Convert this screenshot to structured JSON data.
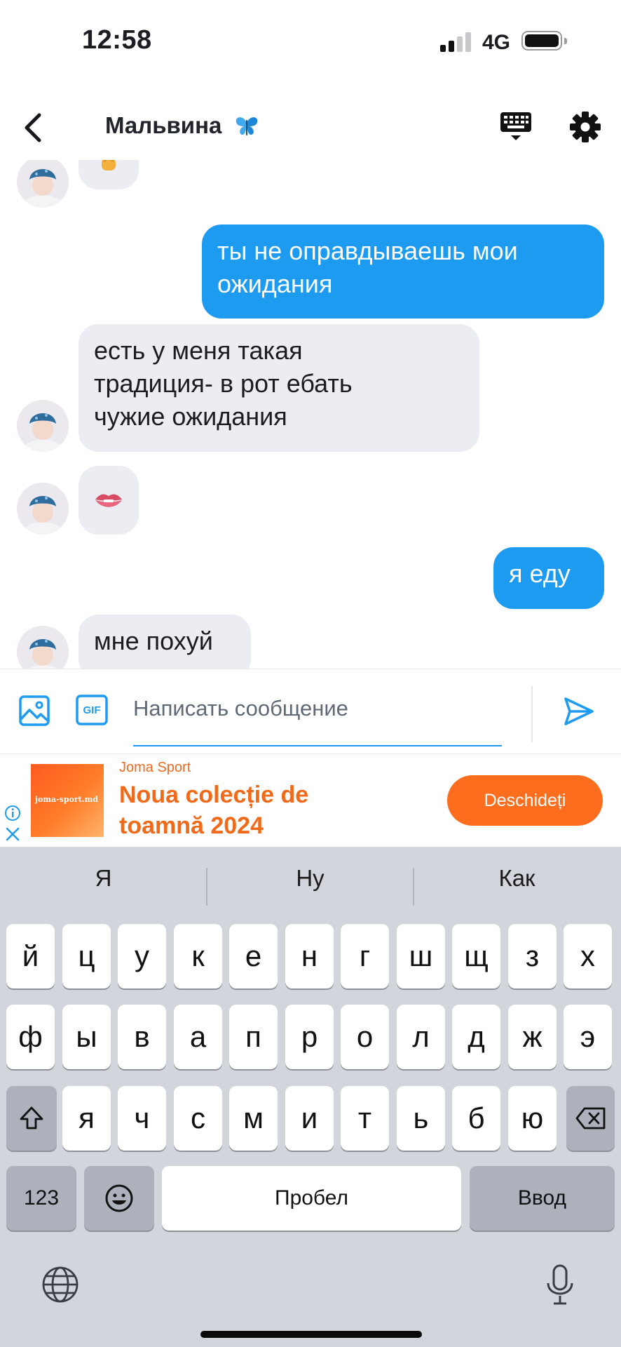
{
  "status_bar": {
    "time": "12:58",
    "network": "4G",
    "signal_bars": 2,
    "battery_fill": 0.9
  },
  "header": {
    "title": "Мальвина",
    "title_icon": "butterfly-icon",
    "back_icon": "chevron-left-icon",
    "keyboard_icon": "keyboard-icon",
    "settings_icon": "gear-icon"
  },
  "messages": [
    {
      "direction": "in",
      "type": "emoji",
      "emoji": "middle-finger-emoji"
    },
    {
      "direction": "out",
      "text_lines": [
        "ты не оправдываешь мои",
        "ожидания"
      ]
    },
    {
      "direction": "in",
      "text_lines": [
        "есть у меня такая",
        "традиция- в рот ебать",
        "чужие ожидания"
      ]
    },
    {
      "direction": "in",
      "type": "emoji",
      "emoji": "biting-lip-emoji"
    },
    {
      "direction": "out",
      "text_lines": [
        "я еду"
      ]
    },
    {
      "direction": "in",
      "text_lines": [
        "мне похуй"
      ]
    }
  ],
  "composer": {
    "placeholder": "Написать сообщение",
    "image_icon": "image-icon",
    "gif_label": "GIF",
    "send_icon": "send-icon"
  },
  "ad": {
    "brand": "Joma Sport",
    "headline": "Noua colecție de toamnă 2024",
    "thumb_text": "joma-sport.md",
    "cta": "Deschideți",
    "accent": "#fc6d1d"
  },
  "keyboard": {
    "suggestions": [
      "Я",
      "Ну",
      "Как"
    ],
    "row1": [
      "й",
      "ц",
      "у",
      "к",
      "е",
      "н",
      "г",
      "ш",
      "щ",
      "з",
      "х"
    ],
    "row2": [
      "ф",
      "ы",
      "в",
      "а",
      "п",
      "р",
      "о",
      "л",
      "д",
      "ж",
      "э"
    ],
    "row3": [
      "я",
      "ч",
      "с",
      "м",
      "и",
      "т",
      "ь",
      "б",
      "ю"
    ],
    "numbers_label": "123",
    "space_label": "Пробел",
    "return_label": "Ввод"
  },
  "colors": {
    "outgoing": "#1d9bf0",
    "incoming": "#ebedf3",
    "accent": "#1d9bf0"
  }
}
